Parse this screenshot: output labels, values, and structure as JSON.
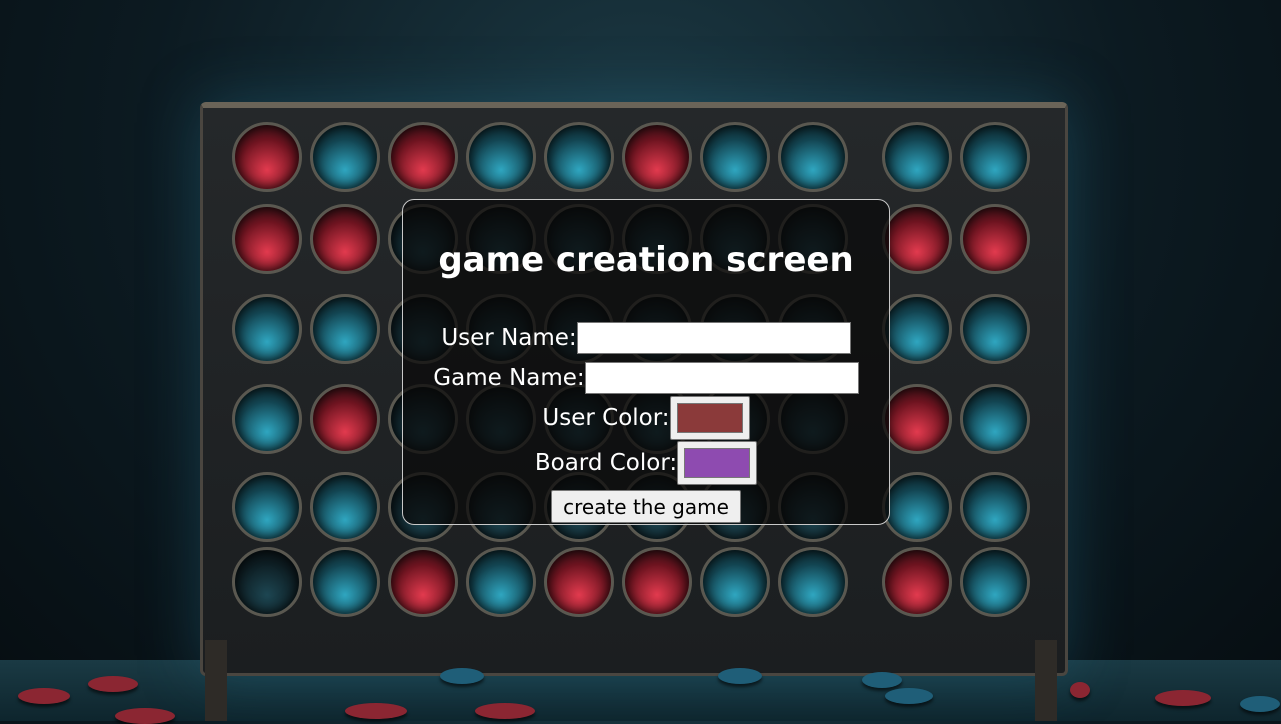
{
  "title": "game creation screen",
  "form": {
    "user_name_label": "User Name:",
    "user_name_value": "",
    "game_name_label": "Game Name:",
    "game_name_value": "",
    "user_color_label": "User Color:",
    "user_color_value": "#8b3a3a",
    "board_color_label": "Board Color:",
    "board_color_value": "#8e4bb0",
    "create_button_label": "create the game"
  }
}
